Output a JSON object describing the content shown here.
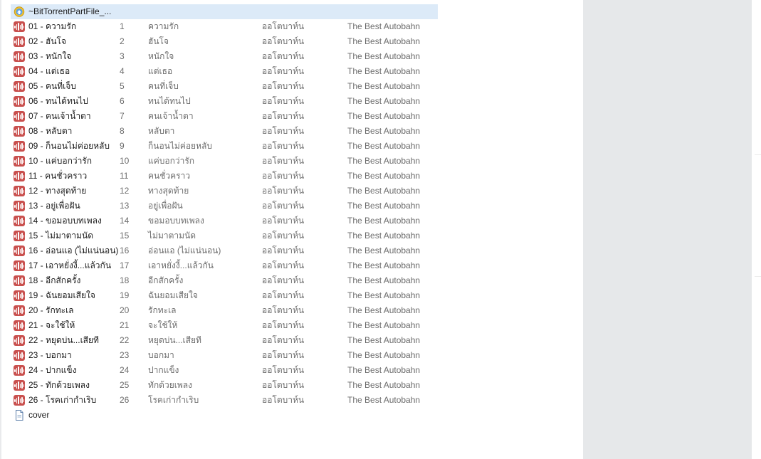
{
  "folder": {
    "name": "~BitTorrentPartFile_...",
    "icon": "torrent-folder-icon"
  },
  "tracks": [
    {
      "file": "01 - ความรัก",
      "num": "1",
      "title": "ความรัก",
      "artist": "ออโตบาห์น",
      "album": "The Best Autobahn"
    },
    {
      "file": "02 - ฮันโจ",
      "num": "2",
      "title": "ฮันโจ",
      "artist": "ออโตบาห์น",
      "album": "The Best Autobahn"
    },
    {
      "file": "03 - หนักใจ",
      "num": "3",
      "title": "หนักใจ",
      "artist": "ออโตบาห์น",
      "album": "The Best Autobahn"
    },
    {
      "file": "04 - แต่เธอ",
      "num": "4",
      "title": "แต่เธอ",
      "artist": "ออโตบาห์น",
      "album": "The Best Autobahn"
    },
    {
      "file": "05 - คนที่เจ็บ",
      "num": "5",
      "title": "คนที่เจ็บ",
      "artist": "ออโตบาห์น",
      "album": "The Best Autobahn"
    },
    {
      "file": "06 - ทนได้ทนไป",
      "num": "6",
      "title": "ทนได้ทนไป",
      "artist": "ออโตบาห์น",
      "album": "The Best Autobahn"
    },
    {
      "file": "07 - คนเจ้าน้ำตา",
      "num": "7",
      "title": "คนเจ้าน้ำตา",
      "artist": "ออโตบาห์น",
      "album": "The Best Autobahn"
    },
    {
      "file": "08 - หลับตา",
      "num": "8",
      "title": "หลับตา",
      "artist": "ออโตบาห์น",
      "album": "The Best Autobahn"
    },
    {
      "file": "09 - ก็นอนไม่ค่อยหลับ",
      "num": "9",
      "title": "ก็นอนไม่ค่อยหลับ",
      "artist": "ออโตบาห์น",
      "album": "The Best Autobahn"
    },
    {
      "file": "10 - แค่บอกว่ารัก",
      "num": "10",
      "title": "แค่บอกว่ารัก",
      "artist": "ออโตบาห์น",
      "album": "The Best Autobahn"
    },
    {
      "file": "11 - คนชั่วคราว",
      "num": "11",
      "title": "คนชั่วคราว",
      "artist": "ออโตบาห์น",
      "album": "The Best Autobahn"
    },
    {
      "file": "12 - ทางสุดท้าย",
      "num": "12",
      "title": "ทางสุดท้าย",
      "artist": "ออโตบาห์น",
      "album": "The Best Autobahn"
    },
    {
      "file": "13 - อยู่เพื่อฝัน",
      "num": "13",
      "title": "อยู่เพื่อฝัน",
      "artist": "ออโตบาห์น",
      "album": "The Best Autobahn"
    },
    {
      "file": "14 - ขอมอบบทเพลง",
      "num": "14",
      "title": "ขอมอบบทเพลง",
      "artist": "ออโตบาห์น",
      "album": "The Best Autobahn"
    },
    {
      "file": "15 - ไม่มาตามนัด",
      "num": "15",
      "title": "ไม่มาตามนัด",
      "artist": "ออโตบาห์น",
      "album": "The Best Autobahn"
    },
    {
      "file": "16 - อ่อนแอ (ไม่แน่นอน)",
      "num": "16",
      "title": "อ่อนแอ (ไม่แน่นอน)",
      "artist": "ออโตบาห์น",
      "album": "The Best Autobahn"
    },
    {
      "file": "17 - เอาหยั่งงี้...แล้วกัน",
      "num": "17",
      "title": "เอาหยั่งงี้...แล้วกัน",
      "artist": "ออโตบาห์น",
      "album": "The Best Autobahn"
    },
    {
      "file": "18 - อีกสักครั้ง",
      "num": "18",
      "title": "อีกสักครั้ง",
      "artist": "ออโตบาห์น",
      "album": "The Best Autobahn"
    },
    {
      "file": "19 - ฉันยอมเสียใจ",
      "num": "19",
      "title": "ฉันยอมเสียใจ",
      "artist": "ออโตบาห์น",
      "album": "The Best Autobahn"
    },
    {
      "file": "20 - รักทะเล",
      "num": "20",
      "title": "รักทะเล",
      "artist": "ออโตบาห์น",
      "album": "The Best Autobahn"
    },
    {
      "file": "21 - จะใช้ให้",
      "num": "21",
      "title": "จะใช้ให้",
      "artist": "ออโตบาห์น",
      "album": "The Best Autobahn"
    },
    {
      "file": "22 - หยุดบ่น...เสียที",
      "num": "22",
      "title": "หยุดบ่น...เสียที",
      "artist": "ออโตบาห์น",
      "album": "The Best Autobahn"
    },
    {
      "file": "23 - บอกมา",
      "num": "23",
      "title": "บอกมา",
      "artist": "ออโตบาห์น",
      "album": "The Best Autobahn"
    },
    {
      "file": "24 - ปากแข็ง",
      "num": "24",
      "title": "ปากแข็ง",
      "artist": "ออโตบาห์น",
      "album": "The Best Autobahn"
    },
    {
      "file": "25 - ทักด้วยเพลง",
      "num": "25",
      "title": "ทักด้วยเพลง",
      "artist": "ออโตบาห์น",
      "album": "The Best Autobahn"
    },
    {
      "file": "26 - โรคเก่ากำเริบ",
      "num": "26",
      "title": "โรคเก่ากำเริบ",
      "artist": "ออโตบาห์น",
      "album": "The Best Autobahn"
    }
  ],
  "cover": {
    "name": "cover",
    "icon": "document-icon"
  },
  "colors": {
    "audio_icon": "#c9504e",
    "selection": "#dceaf8",
    "side_panel": "#e6e8ea"
  }
}
